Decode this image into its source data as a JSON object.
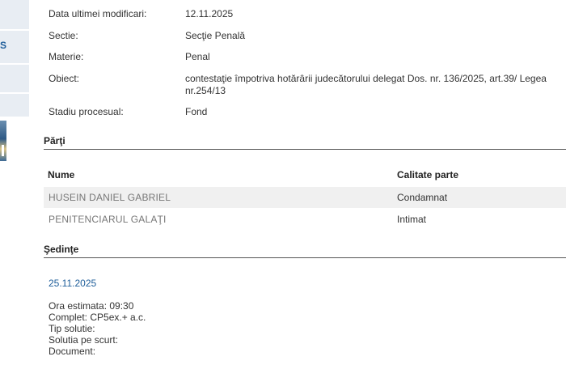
{
  "sidebar": {
    "item_letter": "S"
  },
  "details": {
    "last_modified": {
      "label": "Data ultimei modificari:",
      "value": "12.11.2025"
    },
    "section": {
      "label": "Sectie:",
      "value": "Secţie Penală"
    },
    "subject": {
      "label": "Materie:",
      "value": "Penal"
    },
    "object": {
      "label": "Obiect:",
      "value": "contestaţie împotriva hotărârii judecătorului delegat Dos. nr. 136/2025, art.39/ Legea nr.254/13"
    },
    "stage": {
      "label": "Stadiu procesual:",
      "value": "Fond"
    }
  },
  "parties": {
    "title": "Părţi",
    "headers": {
      "name": "Nume",
      "role": "Calitate parte"
    },
    "rows": [
      {
        "name": "HUSEIN DANIEL GABRIEL",
        "role": "Condamnat"
      },
      {
        "name": "PENITENCIARUL GALAŢI",
        "role": "Intimat"
      }
    ]
  },
  "hearings": {
    "title": "Şedinţe",
    "items": [
      {
        "date": "25.11.2025",
        "time": "Ora estimata: 09:30",
        "panel": "Complet: CP5ex.+ a.c.",
        "solution_type": "Tip solutie:",
        "solution_summary": "Solutia pe scurt:",
        "document": "Document:"
      }
    ]
  }
}
